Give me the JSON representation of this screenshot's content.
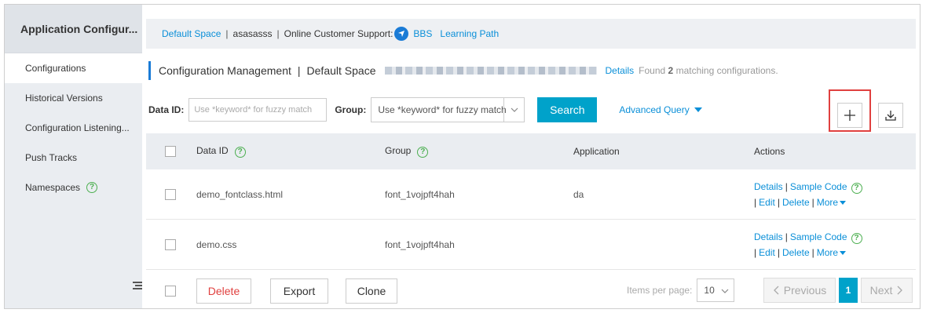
{
  "sidebar": {
    "title": "Application Configur...",
    "items": [
      {
        "label": "Configurations"
      },
      {
        "label": "Historical Versions"
      },
      {
        "label": "Configuration Listening..."
      },
      {
        "label": "Push Tracks"
      },
      {
        "label": "Namespaces"
      }
    ]
  },
  "topbar": {
    "default_space": "Default Space",
    "user": "asasasss",
    "support_label": "Online Customer Support:",
    "bbs": "BBS",
    "learning_path": "Learning Path"
  },
  "title": {
    "main": "Configuration Management",
    "space": "Default Space",
    "details": "Details",
    "found_prefix": "Found",
    "found_count": "2",
    "found_suffix": "matching configurations."
  },
  "search": {
    "data_id_label": "Data ID:",
    "data_id_placeholder": "Use *keyword* for fuzzy match",
    "group_label": "Group:",
    "group_placeholder": "Use *keyword* for fuzzy match",
    "search_button": "Search",
    "advanced": "Advanced Query"
  },
  "table": {
    "columns": [
      "Data ID",
      "Group",
      "Application",
      "Actions"
    ],
    "rows": [
      {
        "data_id": "demo_fontclass.html",
        "group": "font_1vojpft4hah",
        "application": "da"
      },
      {
        "data_id": "demo.css",
        "group": "font_1vojpft4hah",
        "application": ""
      }
    ],
    "actions": {
      "details": "Details",
      "sample_code": "Sample Code",
      "edit": "Edit",
      "delete": "Delete",
      "more": "More"
    }
  },
  "footer": {
    "delete": "Delete",
    "export": "Export",
    "clone": "Clone",
    "items_per_page_label": "Items per page:",
    "items_per_page": "10",
    "previous": "Previous",
    "page": "1",
    "next": "Next"
  },
  "colors": {
    "accent": "#00a2ca",
    "link": "#0a8fd8",
    "highlight": "#e0403f"
  }
}
